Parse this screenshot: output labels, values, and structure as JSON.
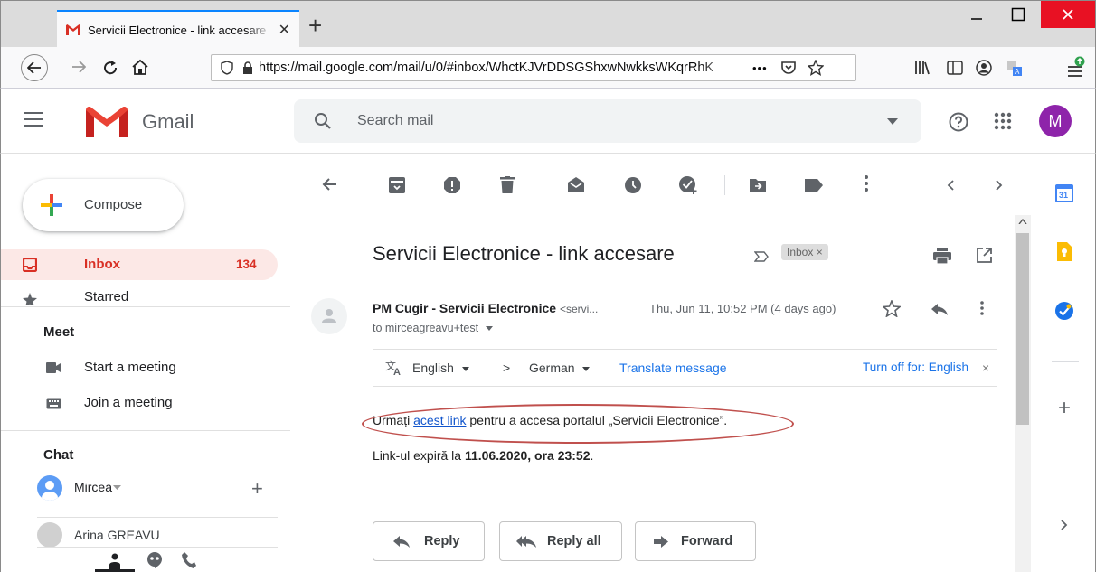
{
  "browser": {
    "tab_title": "Servicii Electronice - link accesare",
    "tab_close": "✕",
    "new_tab": "+",
    "url": "https://mail.google.com/mail/u/0/#inbox/WhctKJVrDDSGShxwNwkksWKqrRhK",
    "url_more": "•••"
  },
  "gmail": {
    "logo_text": "Gmail",
    "search_placeholder": "Search mail",
    "avatar_letter": "M",
    "accent_color": "#d93025"
  },
  "sidebar": {
    "compose_label": "Compose",
    "inbox_label": "Inbox",
    "inbox_count": "134",
    "starred_label": "Starred",
    "meet_heading": "Meet",
    "start_meeting": "Start a meeting",
    "join_meeting": "Join a meeting",
    "chat_heading": "Chat",
    "chat_user": "Mircea",
    "chat_contact": "Arina GREAVU"
  },
  "email": {
    "subject": "Servicii Electronice - link accesare",
    "label_chip": "Inbox ×",
    "sender_name": "PM Cugir - Servicii Electronice",
    "sender_email": "<servi...",
    "date": "Thu, Jun 11, 10:52 PM (4 days ago)",
    "to": "to mirceagreavu+test",
    "translate": {
      "from_lang": "English",
      "arrow": ">",
      "to_lang": "German",
      "translate_link": "Translate message",
      "turn_off": "Turn off for: English"
    },
    "body_pre": "Urmați ",
    "body_link": "acest link",
    "body_post": " pentru a accesa portalul „Servicii Electronice”.",
    "body2_pre": "Link-ul expiră la ",
    "body2_bold": "11.06.2020, ora 23:52",
    "body2_post": ".",
    "reply_label": "Reply",
    "reply_all_label": "Reply all",
    "forward_label": "Forward"
  }
}
